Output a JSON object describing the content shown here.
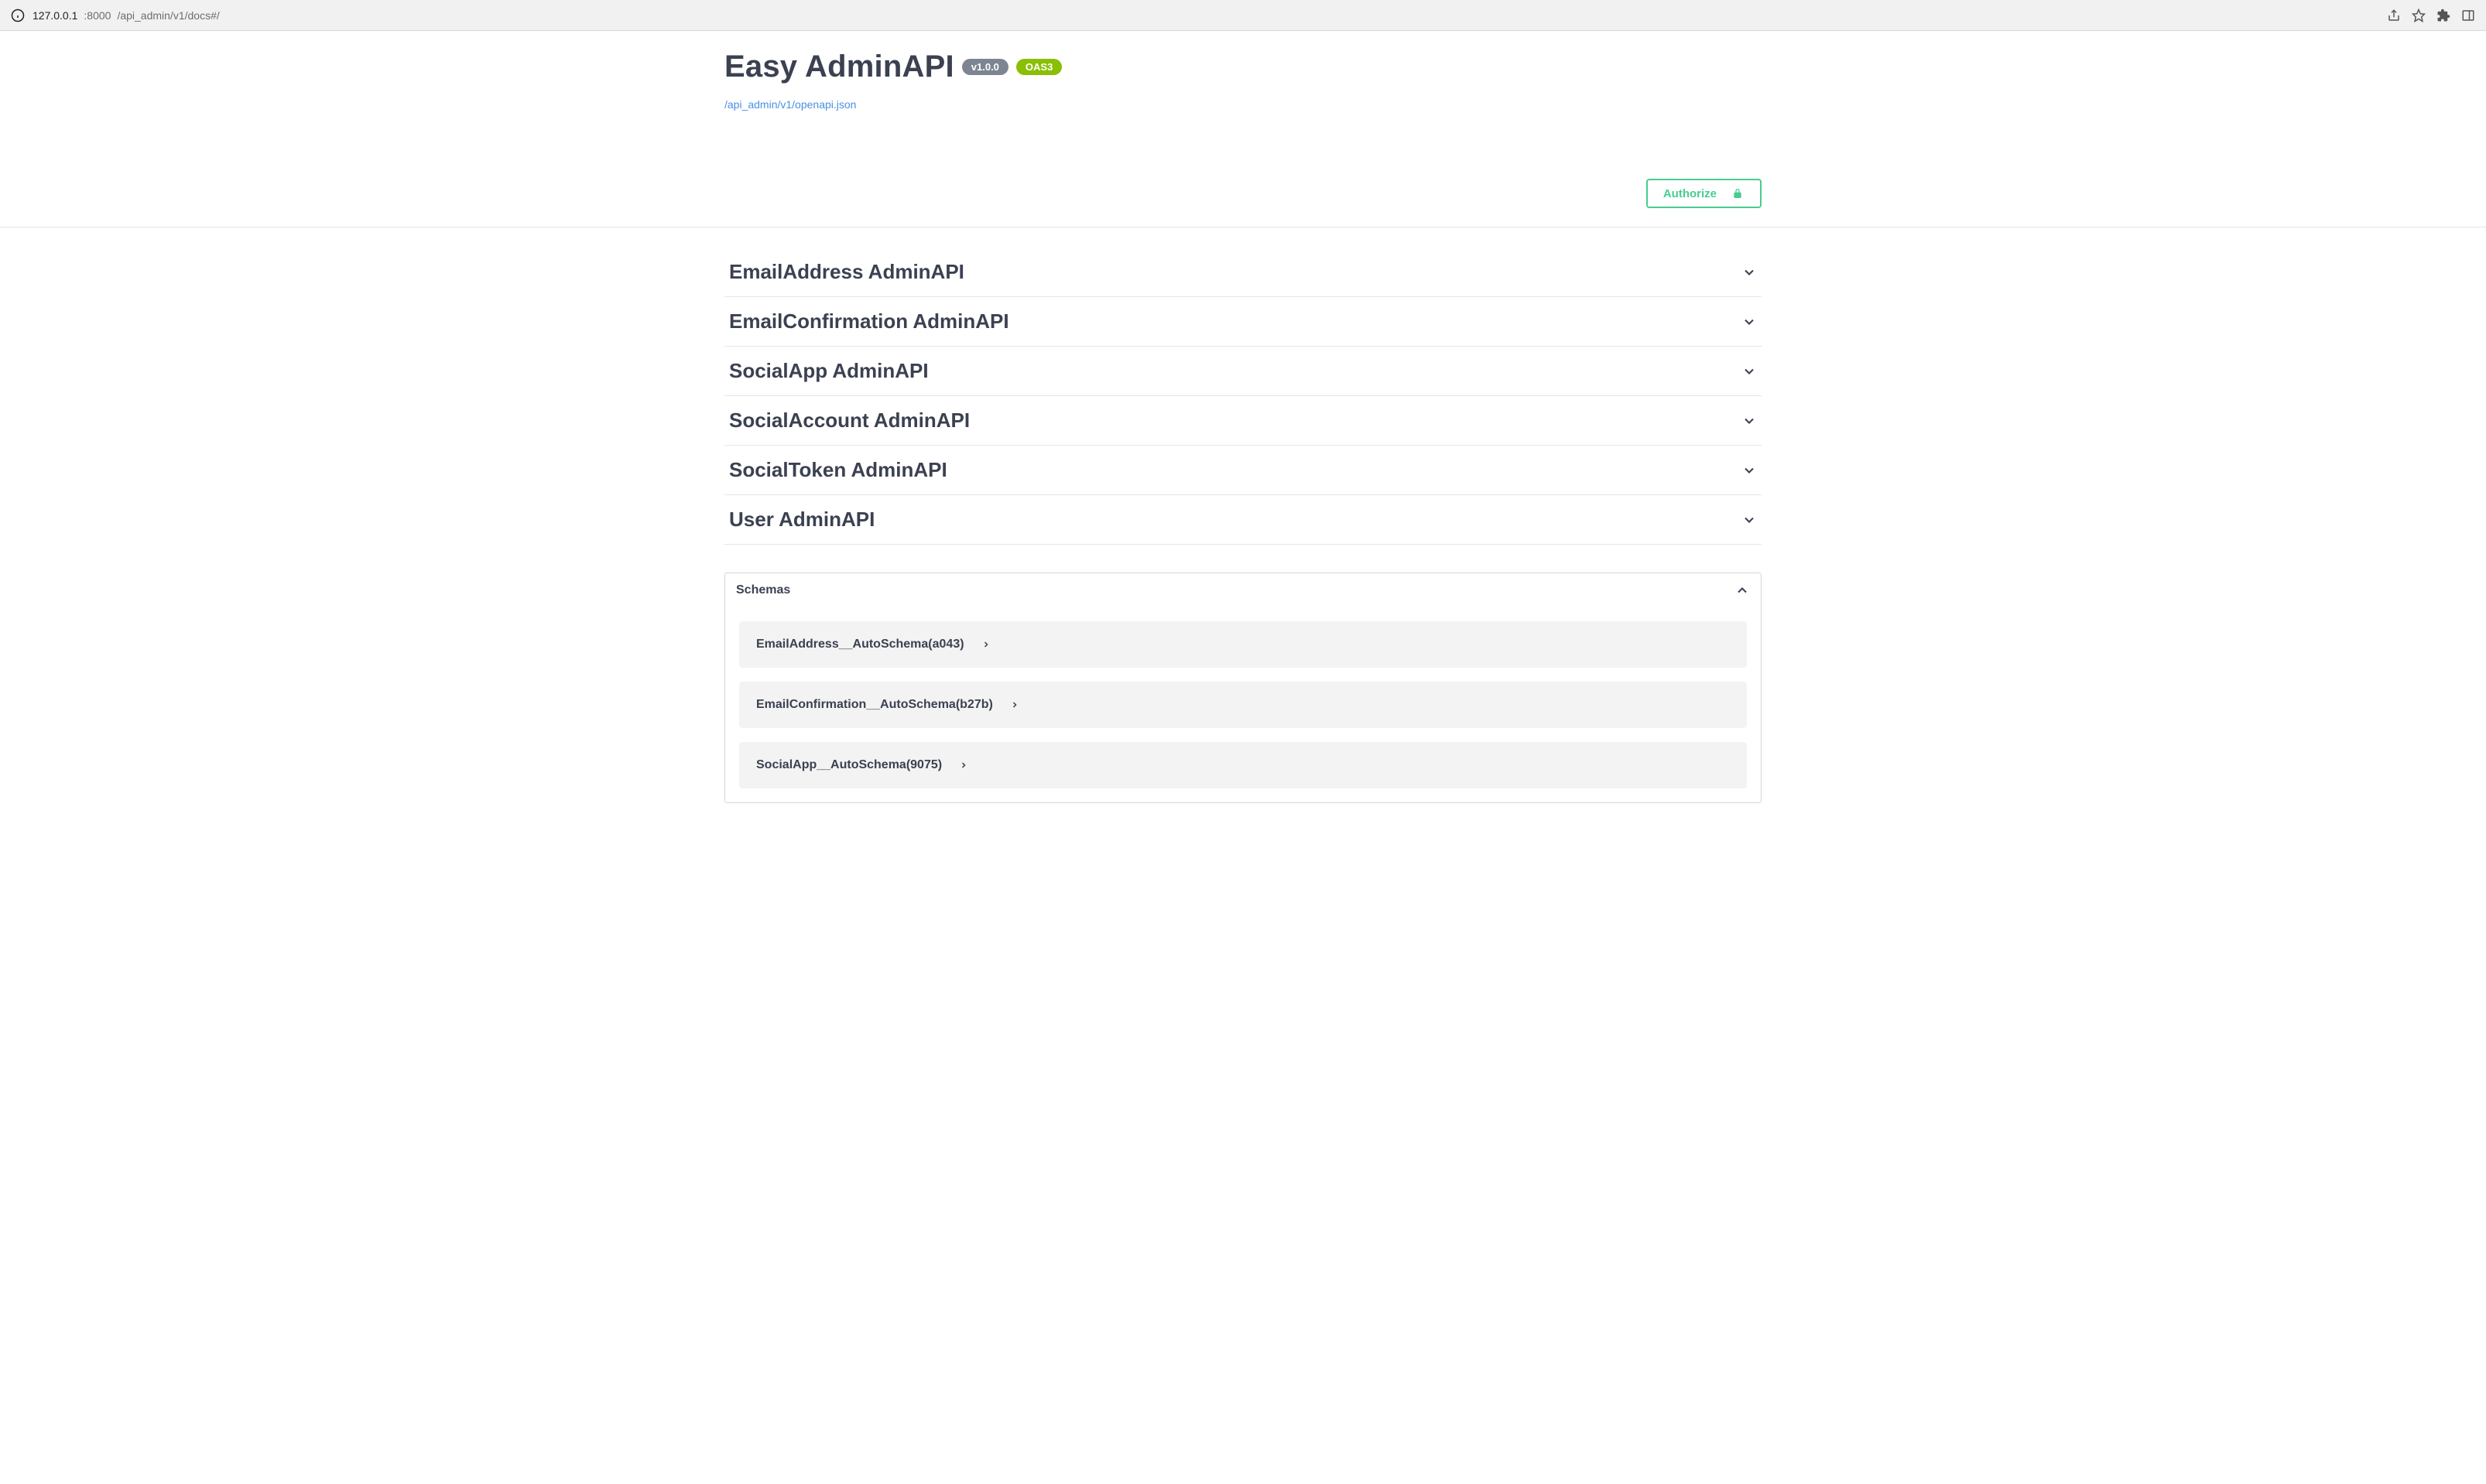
{
  "browser": {
    "url_host": "127.0.0.1",
    "url_port": ":8000",
    "url_path": "/api_admin/v1/docs#/"
  },
  "header": {
    "title": "Easy AdminAPI",
    "version_badge": "v1.0.0",
    "oas_badge": "OAS3",
    "spec_link": "/api_admin/v1/openapi.json"
  },
  "authorize": {
    "label": "Authorize"
  },
  "tags": [
    {
      "title": "EmailAddress AdminAPI"
    },
    {
      "title": "EmailConfirmation AdminAPI"
    },
    {
      "title": "SocialApp AdminAPI"
    },
    {
      "title": "SocialAccount AdminAPI"
    },
    {
      "title": "SocialToken AdminAPI"
    },
    {
      "title": "User AdminAPI"
    }
  ],
  "schemas": {
    "header": "Schemas",
    "items": [
      {
        "name": "EmailAddress__AutoSchema(a043)"
      },
      {
        "name": "EmailConfirmation__AutoSchema(b27b)"
      },
      {
        "name": "SocialApp__AutoSchema(9075)"
      }
    ]
  }
}
